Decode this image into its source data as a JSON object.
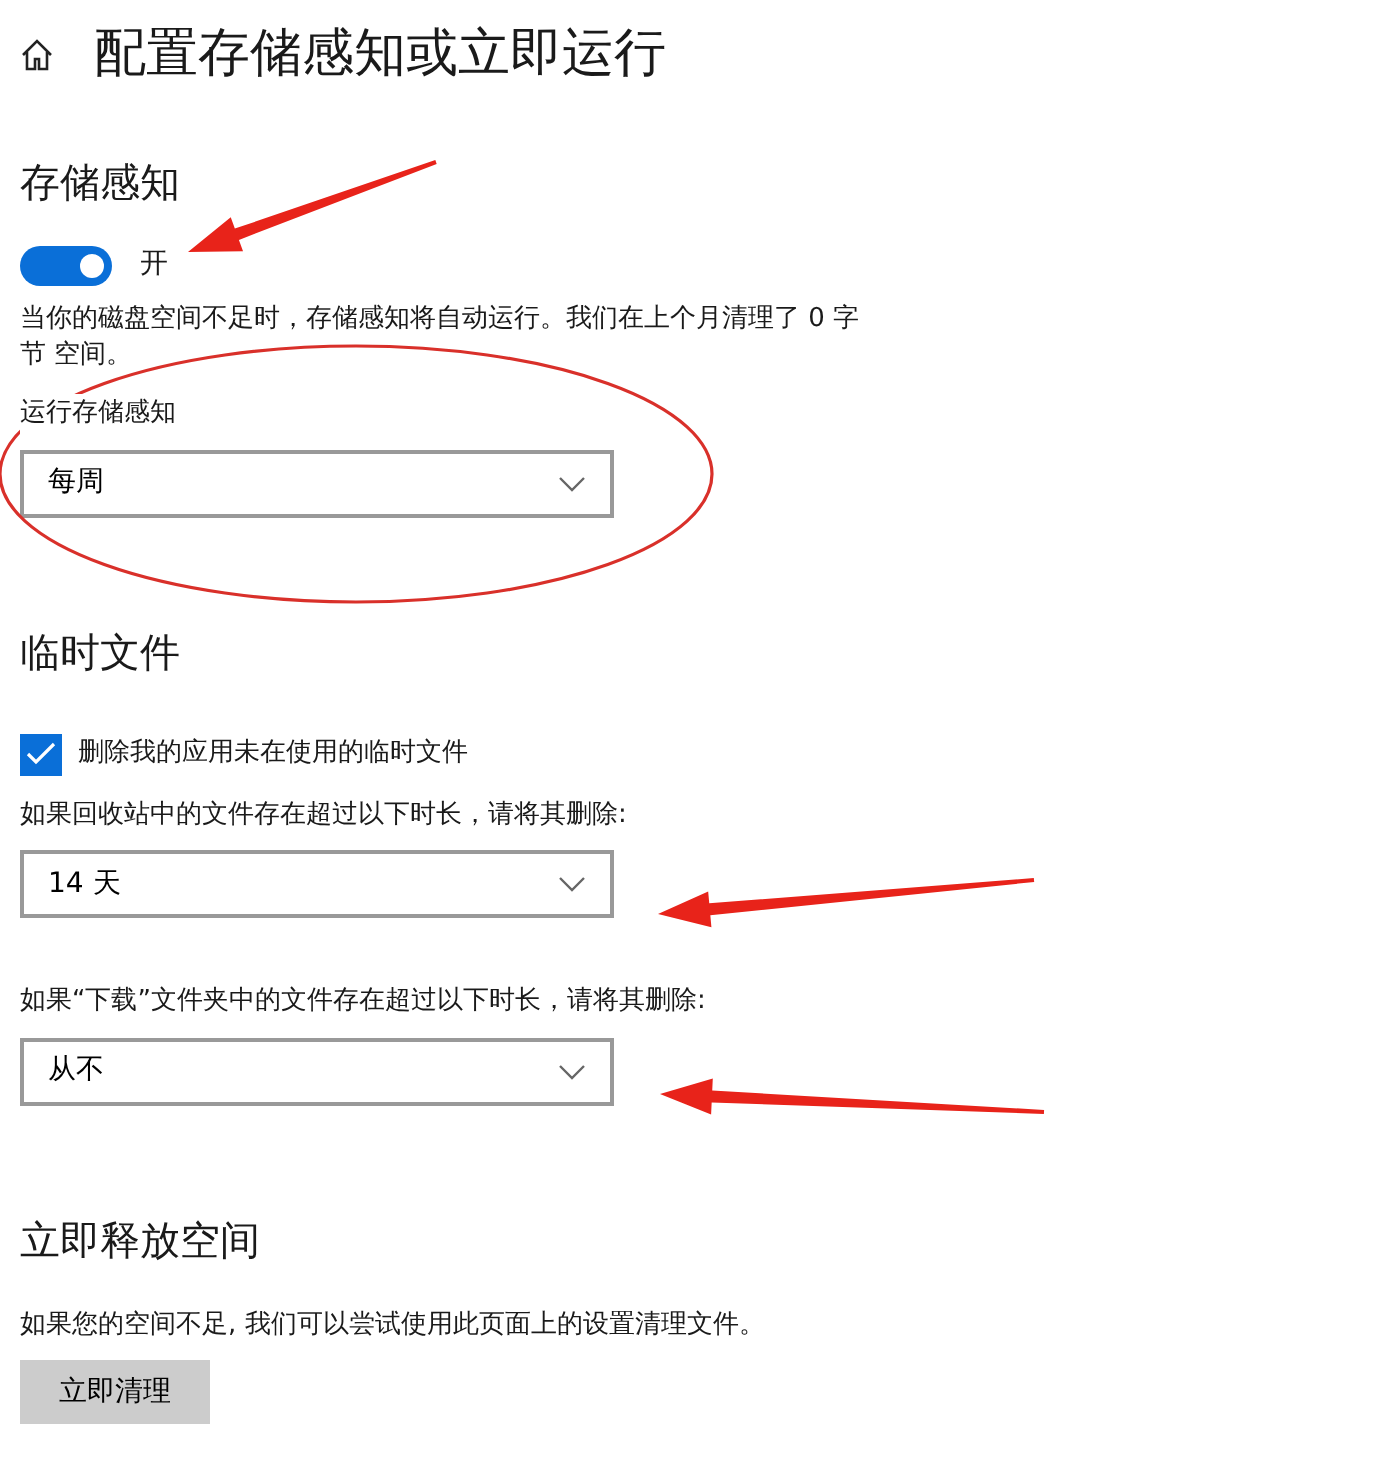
{
  "page": {
    "title": "配置存储感知或立即运行"
  },
  "storage_sense": {
    "heading": "存储感知",
    "toggle": {
      "on": true,
      "label": "开"
    },
    "description": "当你的磁盘空间不足时，存储感知将自动运行。我们在上个月清理了 0 字节 空间。",
    "run_label": "运行存储感知",
    "run_value": "每周"
  },
  "temp_files": {
    "heading": "临时文件",
    "checkbox": {
      "checked": true,
      "label": "删除我的应用未在使用的临时文件"
    },
    "settings": [
      {
        "label": "如果回收站中的文件存在超过以下时长，请将其删除:",
        "value": "14 天"
      },
      {
        "label": "如果“下载”文件夹中的文件存在超过以下时长，请将其删除:",
        "value": "从不"
      }
    ]
  },
  "free_space": {
    "heading": "立即释放空间",
    "description": "如果您的空间不足, 我们可以尝试使用此页面上的设置清理文件。",
    "button": "立即清理"
  }
}
